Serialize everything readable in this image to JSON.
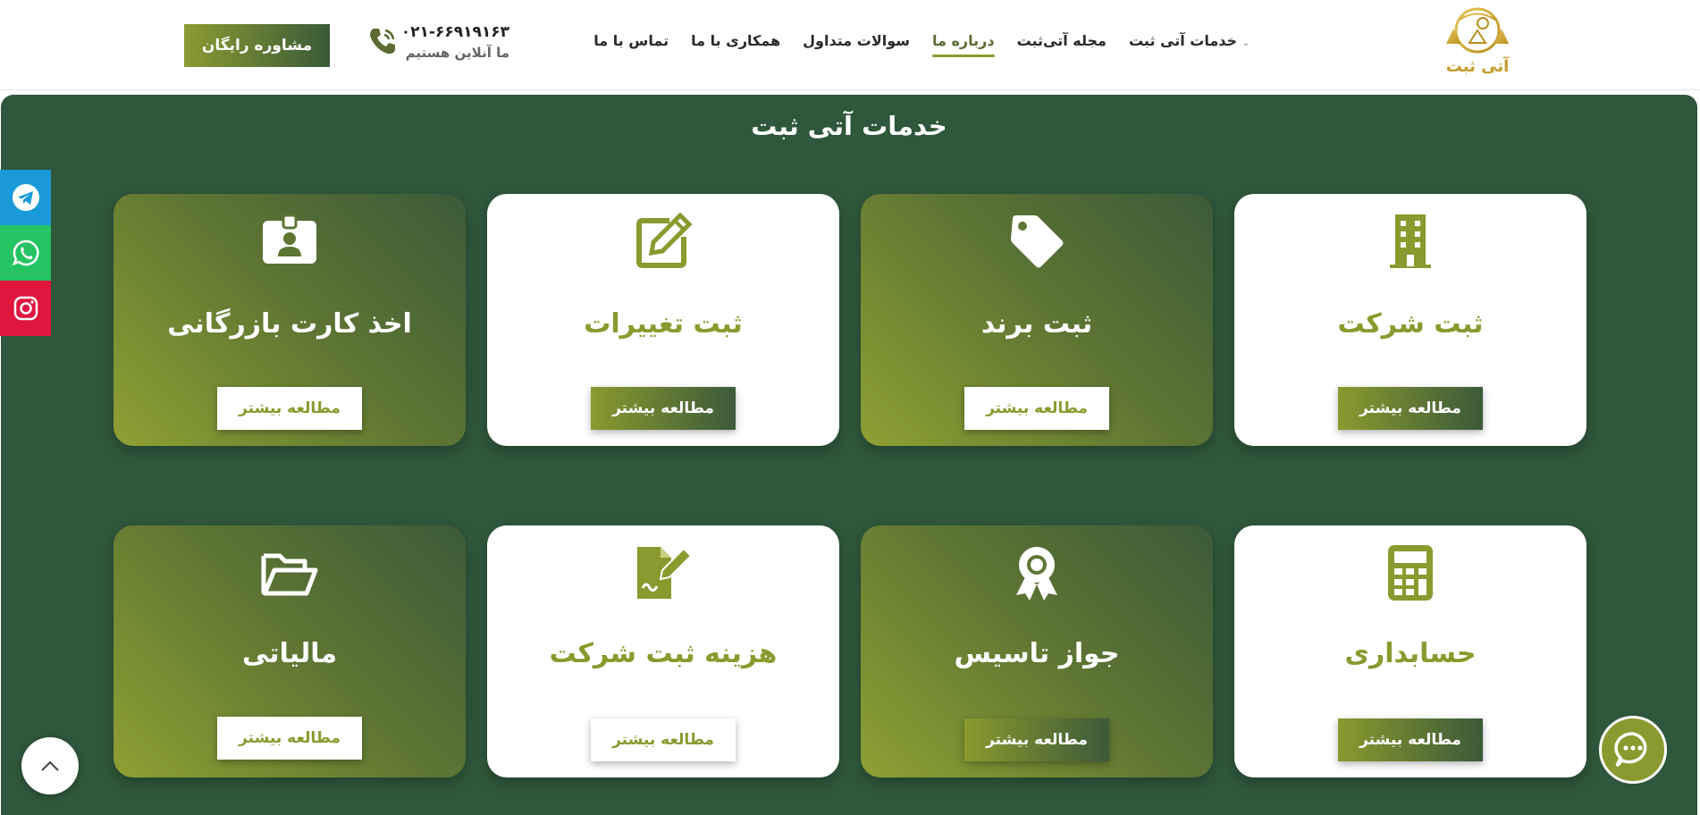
{
  "header": {
    "logo_text": "آتی ثبت",
    "nav": [
      {
        "label": "خدمات آتی ثبت",
        "has_caret": true
      },
      {
        "label": "مجله آتی‌ثبت"
      },
      {
        "label": "درباره ما",
        "active": true
      },
      {
        "label": "سوالات متداول"
      },
      {
        "label": "همکاری با ما"
      },
      {
        "label": "تماس با ما"
      }
    ],
    "phone_number": "۰۲۱-۶۶۹۱۹۱۶۳",
    "phone_status": "ما آنلاین هستیم",
    "consult_button": "مشاوره رایگان"
  },
  "section": {
    "title": "خدمات آتی ثبت"
  },
  "cards": [
    {
      "title": "ثبت شرکت",
      "icon": "building-icon",
      "button": "مطالعه بیشتر"
    },
    {
      "title": "ثبت برند",
      "icon": "tag-icon",
      "button": "مطالعه بیشتر"
    },
    {
      "title": "ثبت تغییرات",
      "icon": "edit-icon",
      "button": "مطالعه بیشتر"
    },
    {
      "title": "اخذ کارت بازرگانی",
      "icon": "id-card-icon",
      "button": "مطالعه بیشتر"
    },
    {
      "title": "حسابداری",
      "icon": "calculator-icon",
      "button": "مطالعه بیشتر"
    },
    {
      "title": "جواز تاسیس",
      "icon": "award-icon",
      "button": "مطالعه بیشتر"
    },
    {
      "title": "هزینه ثبت شرکت",
      "icon": "file-signature-icon",
      "button": "مطالعه بیشتر"
    },
    {
      "title": "مالیاتی",
      "icon": "folder-open-icon",
      "button": "مطالعه بیشتر"
    }
  ],
  "social": [
    {
      "name": "telegram",
      "color": "#1a9ad8"
    },
    {
      "name": "whatsapp",
      "color": "#25c364"
    },
    {
      "name": "instagram",
      "color": "#e0163e"
    }
  ],
  "colors": {
    "brand_olive": "#8a9a2e",
    "brand_dark_green": "#2f573b",
    "white": "#ffffff"
  }
}
